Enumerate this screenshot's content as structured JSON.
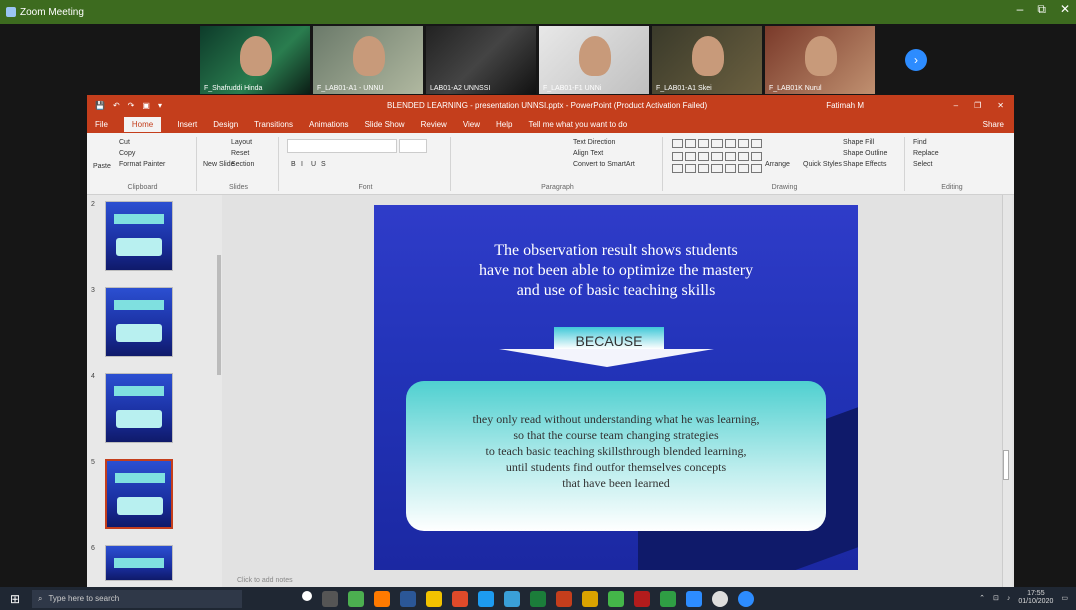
{
  "zoom": {
    "window_title": "Zoom Meeting",
    "win_controls": [
      "–",
      "⧉",
      "✕"
    ],
    "participants": [
      {
        "name": "F_Shafruddi Hinda"
      },
      {
        "name": "F_LAB01-A1 - UNNU"
      },
      {
        "name": "LAB01-A2 UNNSSI"
      },
      {
        "name": "F_LAB01-F1 UNNi"
      },
      {
        "name": "F_LAB01-A1 Skei"
      },
      {
        "name": "F_LAB01K Nurul"
      }
    ],
    "next_icon": "chevron-right-icon"
  },
  "ppt": {
    "quick_access": [
      "💾",
      "↶",
      "↷",
      "▣",
      "▾"
    ],
    "doc_title": "BLENDED LEARNING - presentation UNNSI.pptx - PowerPoint (Product Activation Failed)",
    "user": "Fatimah M",
    "win_controls": [
      "–",
      "❐",
      "✕"
    ],
    "tabs": [
      "File",
      "Home",
      "Insert",
      "Design",
      "Transitions",
      "Animations",
      "Slide Show",
      "Review",
      "View",
      "Help",
      "Tell me what you want to do"
    ],
    "active_tab": "Home",
    "share": "Share",
    "ribbon": {
      "clipboard": {
        "paste": "Paste",
        "cut": "Cut",
        "copy": "Copy",
        "format_painter": "Format Painter",
        "label": "Clipboard"
      },
      "slides": {
        "new_slide": "New Slide",
        "layout": "Layout",
        "reset": "Reset",
        "section": "Section",
        "label": "Slides"
      },
      "font": {
        "label": "Font",
        "bold": "B",
        "italic": "I",
        "underline": "U",
        "shadow": "S"
      },
      "paragraph": {
        "label": "Paragraph",
        "text_direction": "Text Direction",
        "align_text": "Align Text",
        "smartart": "Convert to SmartArt"
      },
      "drawing": {
        "arrange": "Arrange",
        "quick_styles": "Quick Styles",
        "shape_fill": "Shape Fill",
        "shape_outline": "Shape Outline",
        "shape_effects": "Shape Effects",
        "label": "Drawing"
      },
      "editing": {
        "find": "Find",
        "replace": "Replace",
        "select": "Select",
        "label": "Editing"
      }
    },
    "slide_numbers": [
      "2",
      "3",
      "4",
      "5",
      "6"
    ],
    "notes_placeholder": "Click to add notes"
  },
  "slide": {
    "heading_lines": [
      "The observation result shows students",
      "have not been able to optimize the mastery",
      "and use of basic teaching skills"
    ],
    "because": "BECAUSE",
    "body_lines": [
      "they only read without understanding what he was learning,",
      "so that the course team changing strategies",
      "to teach basic teaching skillsthrough blended learning,",
      "until students find outfor themselves concepts",
      "that have been learned"
    ],
    "colors": {
      "background": "#2f3cc9",
      "callout": "#4fd0d0",
      "arrow": "#8fe6f0"
    }
  },
  "taskbar": {
    "search_placeholder": "Type here to search",
    "time": "17:55",
    "date": "01/10/2020"
  }
}
